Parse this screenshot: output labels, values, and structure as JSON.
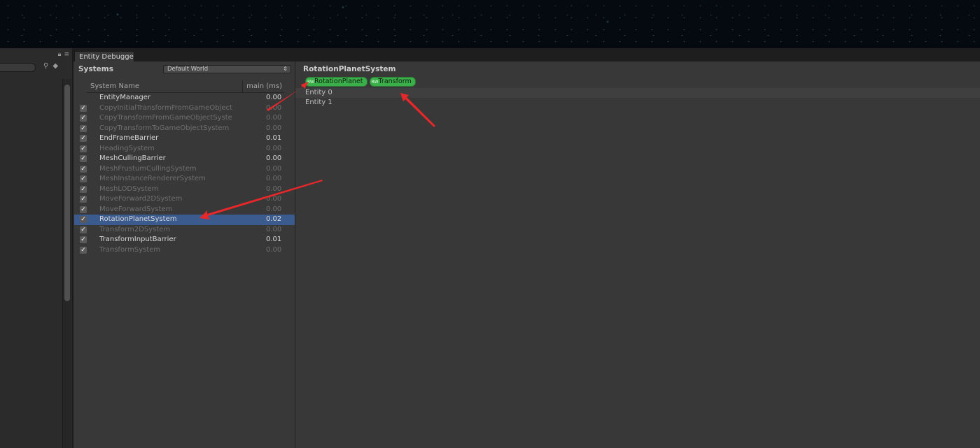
{
  "window": {
    "tab_label": "Entity Debugge"
  },
  "left_panel": {
    "lock_icon": "lock-icon",
    "menu_icon": "menu-icon"
  },
  "systems": {
    "title": "Systems",
    "world_dropdown": "Default World",
    "columns": {
      "name": "System Name",
      "time": "main (ms)"
    },
    "rows": [
      {
        "name": "EntityManager",
        "time": "0.00",
        "checkbox": false,
        "active": true
      },
      {
        "name": "CopyInitialTransformFromGameObject",
        "time": "0.00",
        "checkbox": true,
        "active": false
      },
      {
        "name": "CopyTransformFromGameObjectSyste",
        "time": "0.00",
        "checkbox": true,
        "active": false
      },
      {
        "name": "CopyTransformToGameObjectSystem",
        "time": "0.00",
        "checkbox": true,
        "active": false
      },
      {
        "name": "EndFrameBarrier",
        "time": "0.01",
        "checkbox": true,
        "active": true
      },
      {
        "name": "HeadingSystem",
        "time": "0.00",
        "checkbox": true,
        "active": false
      },
      {
        "name": "MeshCullingBarrier",
        "time": "0.00",
        "checkbox": true,
        "active": true
      },
      {
        "name": "MeshFrustumCullingSystem",
        "time": "0.00",
        "checkbox": true,
        "active": false
      },
      {
        "name": "MeshInstanceRendererSystem",
        "time": "0.00",
        "checkbox": true,
        "active": false
      },
      {
        "name": "MeshLODSystem",
        "time": "0.00",
        "checkbox": true,
        "active": false
      },
      {
        "name": "MoveForward2DSystem",
        "time": "0.00",
        "checkbox": true,
        "active": false
      },
      {
        "name": "MoveForwardSystem",
        "time": "0.00",
        "checkbox": true,
        "active": false
      },
      {
        "name": "RotationPlanetSystem",
        "time": "0.02",
        "checkbox": true,
        "active": true,
        "selected": true
      },
      {
        "name": "Transform2DSystem",
        "time": "0.00",
        "checkbox": true,
        "active": false
      },
      {
        "name": "TransformInputBarrier",
        "time": "0.01",
        "checkbox": true,
        "active": true
      },
      {
        "name": "TransformSystem",
        "time": "0.00",
        "checkbox": true,
        "active": false
      }
    ]
  },
  "detail": {
    "title": "RotationPlanetSystem",
    "components": [
      {
        "label": "RotationPlanet",
        "badge": "RW"
      },
      {
        "label": "Transform",
        "badge": "RW"
      }
    ],
    "entities": [
      "Entity 0",
      "Entity 1"
    ]
  },
  "colors": {
    "selection": "#3b5b8f",
    "component_chip": "#3bb04a",
    "annotation_arrow": "#e8272a"
  }
}
